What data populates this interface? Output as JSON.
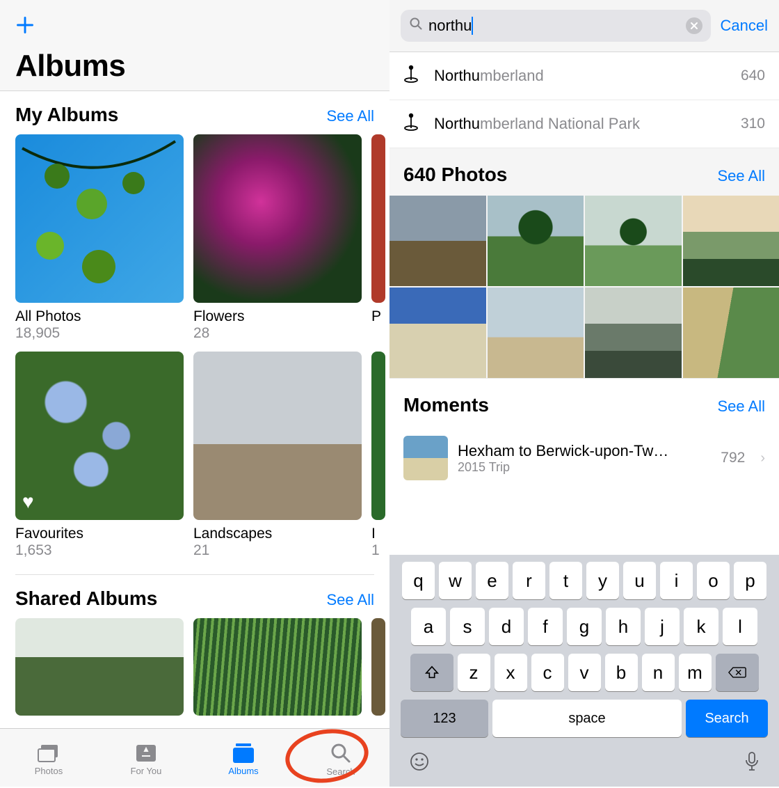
{
  "left": {
    "title": "Albums",
    "sections": {
      "my_albums": {
        "title": "My Albums",
        "see_all": "See All"
      },
      "shared": {
        "title": "Shared Albums",
        "see_all": "See All"
      }
    },
    "albums": [
      {
        "name": "All Photos",
        "count": "18,905"
      },
      {
        "name": "Flowers",
        "count": "28"
      },
      {
        "name": "P",
        "count": ""
      },
      {
        "name": "Favourites",
        "count": "1,653"
      },
      {
        "name": "Landscapes",
        "count": "21"
      },
      {
        "name": "I",
        "count": "1"
      }
    ],
    "tabs": [
      {
        "label": "Photos"
      },
      {
        "label": "For You"
      },
      {
        "label": "Albums"
      },
      {
        "label": "Search"
      }
    ],
    "active_tab": "Albums"
  },
  "right": {
    "search": {
      "value": "northu",
      "cancel": "Cancel"
    },
    "suggestions": [
      {
        "prefix": "Northu",
        "suffix": "mberland",
        "count": "640"
      },
      {
        "prefix": "Northu",
        "suffix": "mberland National Park",
        "count": "310"
      }
    ],
    "photos_section": {
      "title": "640 Photos",
      "see_all": "See All"
    },
    "moments_section": {
      "title": "Moments",
      "see_all": "See All"
    },
    "moment": {
      "title": "Hexham to Berwick-upon-Tw…",
      "subtitle": "2015 Trip",
      "count": "792"
    },
    "keyboard": {
      "r1": [
        "q",
        "w",
        "e",
        "r",
        "t",
        "y",
        "u",
        "i",
        "o",
        "p"
      ],
      "r2": [
        "a",
        "s",
        "d",
        "f",
        "g",
        "h",
        "j",
        "k",
        "l"
      ],
      "r3": [
        "z",
        "x",
        "c",
        "v",
        "b",
        "n",
        "m"
      ],
      "num": "123",
      "space": "space",
      "action": "Search"
    }
  }
}
